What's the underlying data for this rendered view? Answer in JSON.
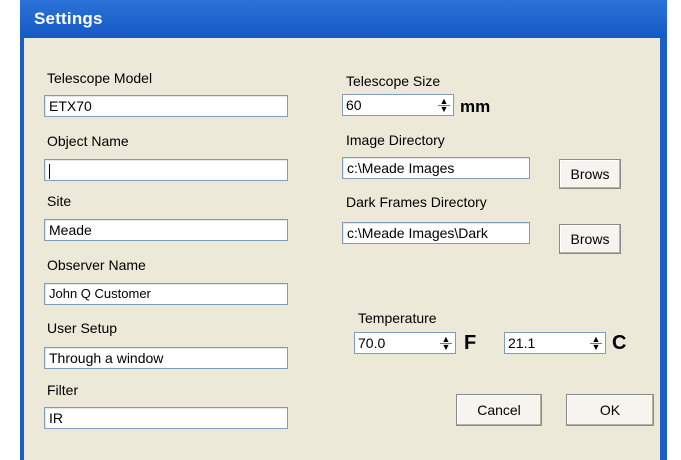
{
  "window": {
    "title": "Settings"
  },
  "left": {
    "telescope_model": {
      "label": "Telescope Model",
      "value": "ETX70"
    },
    "object_name": {
      "label": "Object Name",
      "value": ""
    },
    "site": {
      "label": "Site",
      "value": "Meade"
    },
    "observer_name": {
      "label": "Observer Name",
      "value": "John Q Customer"
    },
    "user_setup": {
      "label": "User Setup",
      "value": "Through a window"
    },
    "filter": {
      "label": "Filter",
      "value": "IR"
    }
  },
  "right": {
    "telescope_size": {
      "label": "Telescope Size",
      "value": "60",
      "unit": "mm"
    },
    "image_directory": {
      "label": "Image Directory",
      "value": "c:\\Meade Images",
      "browse_label": "Brows"
    },
    "dark_frames_directory": {
      "label": "Dark Frames Directory",
      "value": "c:\\Meade Images\\Dark",
      "browse_label": "Brows"
    },
    "temperature": {
      "label": "Temperature",
      "f_value": "70.0",
      "f_unit": "F",
      "c_value": "21.1",
      "c_unit": "C"
    }
  },
  "buttons": {
    "cancel": "Cancel",
    "ok": "OK"
  },
  "colors": {
    "titlebar": "#1a5ec6",
    "client_bg": "#ece9d8",
    "field_border": "#7f9db9"
  }
}
